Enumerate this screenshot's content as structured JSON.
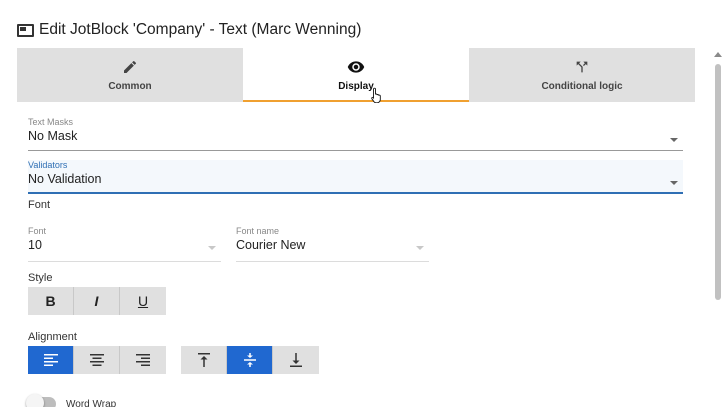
{
  "dialog": {
    "title": "Edit JotBlock 'Company' - Text (Marc Wenning)",
    "title_icon": "window-icon"
  },
  "tabs": [
    {
      "label": "Common",
      "icon": "pencil-icon",
      "active": false
    },
    {
      "label": "Display",
      "icon": "eye-icon",
      "active": true
    },
    {
      "label": "Conditional logic",
      "icon": "branch-icon",
      "active": false
    }
  ],
  "text_masks": {
    "label": "Text Masks",
    "value": "No Mask"
  },
  "validators": {
    "label": "Validators",
    "value": "No Validation"
  },
  "font_section": {
    "heading": "Font",
    "font": {
      "label": "Font",
      "value": "10"
    },
    "font_name": {
      "label": "Font name",
      "value": "Courier New"
    }
  },
  "style": {
    "heading": "Style",
    "buttons": [
      {
        "label": "B",
        "name": "bold"
      },
      {
        "label": "I",
        "name": "italic"
      },
      {
        "label": "U",
        "name": "underline"
      }
    ]
  },
  "alignment": {
    "heading": "Alignment",
    "horizontal": [
      {
        "name": "align-left",
        "active": true
      },
      {
        "name": "align-center",
        "active": false
      },
      {
        "name": "align-right",
        "active": false
      }
    ],
    "vertical": [
      {
        "name": "align-top",
        "active": false
      },
      {
        "name": "align-middle",
        "active": true
      },
      {
        "name": "align-bottom",
        "active": false
      }
    ]
  },
  "word_wrap": {
    "label": "Word Wrap",
    "on": false
  },
  "colors": {
    "accent": "#2068d0",
    "tab_indicator": "#f0a030",
    "focus": "#2f6fb4"
  }
}
